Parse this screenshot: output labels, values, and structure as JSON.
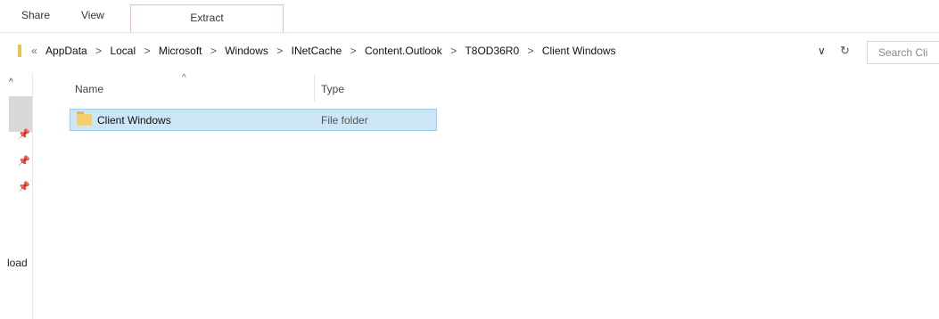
{
  "ribbon": {
    "tabs": [
      {
        "label": "Share"
      },
      {
        "label": "View"
      },
      {
        "label": "Extract"
      }
    ]
  },
  "address": {
    "lead": "«",
    "crumbs": [
      "AppData",
      "Local",
      "Microsoft",
      "Windows",
      "INetCache",
      "Content.Outlook",
      "T8OD36R0",
      "Client Windows"
    ],
    "separator": ">",
    "dropdown": "∨",
    "refresh": "↻"
  },
  "search": {
    "placeholder": "Search Cli"
  },
  "nav": {
    "scroll_up": "^",
    "pins": [
      "📌",
      "📌",
      "📌"
    ],
    "partial_label": "load"
  },
  "columns": {
    "name": "Name",
    "type": "Type",
    "sort_indicator": "^"
  },
  "rows": [
    {
      "name": "Client Windows",
      "type": "File folder"
    }
  ],
  "colors": {
    "selection_bg": "#cce6f8",
    "selection_border": "#9ccce8",
    "folder": "#f2d06b",
    "tab_outline": "#f3b6cf"
  }
}
